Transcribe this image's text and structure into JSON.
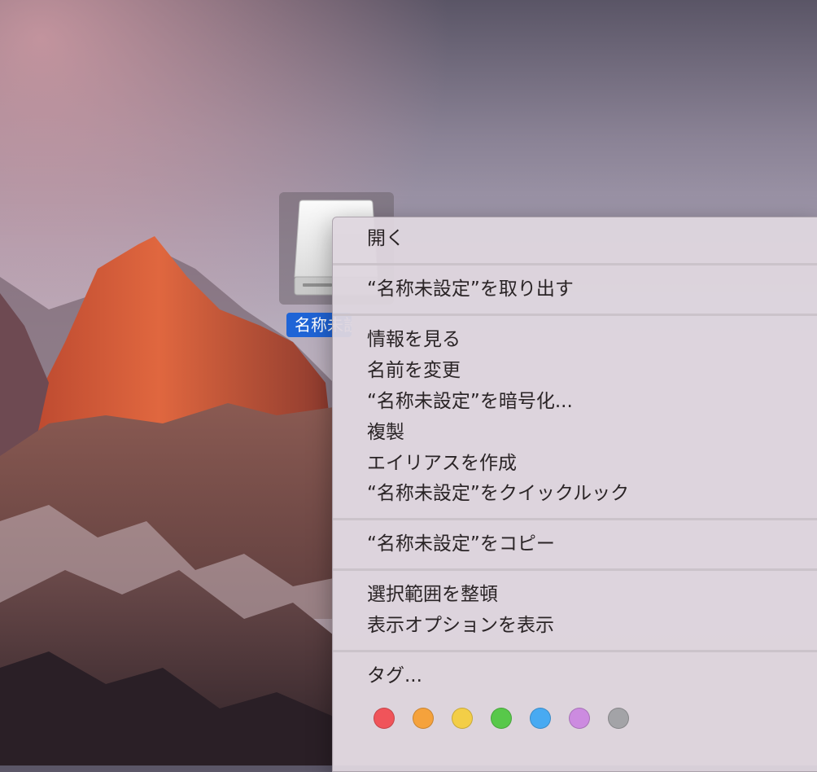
{
  "desktop": {
    "drive_label": "名称未設定"
  },
  "menu": {
    "items": [
      {
        "label": "開く"
      },
      {
        "label": "“名称未設定”を取り出す"
      },
      {
        "label": "情報を見る"
      },
      {
        "label": "名前を変更"
      },
      {
        "label": "“名称未設定”を暗号化..."
      },
      {
        "label": "複製"
      },
      {
        "label": "エイリアスを作成"
      },
      {
        "label": "“名称未設定”をクイックルック"
      },
      {
        "label": "“名称未設定”をコピー"
      },
      {
        "label": "選択範囲を整頓"
      },
      {
        "label": "表示オプションを表示"
      },
      {
        "label": "タグ..."
      }
    ],
    "tag_colors": [
      {
        "name": "red",
        "color": "#f0545a"
      },
      {
        "name": "orange",
        "color": "#f5a23c"
      },
      {
        "name": "yellow",
        "color": "#f3ce47"
      },
      {
        "name": "green",
        "color": "#58c84a"
      },
      {
        "name": "blue",
        "color": "#48aaf2"
      },
      {
        "name": "purple",
        "color": "#cc8be0"
      },
      {
        "name": "gray",
        "color": "#a3a3a7"
      }
    ]
  }
}
